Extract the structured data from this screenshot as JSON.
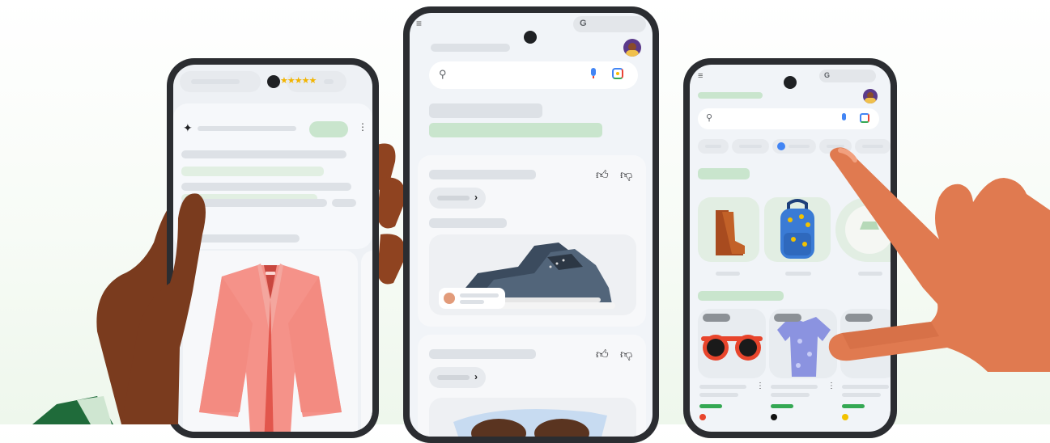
{
  "left_phone": {
    "rating_stars": "★★★★★",
    "ai_icon_name": "sparkle-icon",
    "product_icon_name": "pink-blazer"
  },
  "center_phone": {
    "search": {
      "icon": "search-icon",
      "mic": "mic-icon",
      "lens": "lens-icon"
    },
    "results": [
      {
        "product": "sneakers",
        "actions": [
          "thumbs-up-icon",
          "thumbs-down-icon"
        ]
      },
      {
        "product": "sunglasses",
        "actions": [
          "thumbs-up-icon",
          "thumbs-down-icon"
        ]
      }
    ]
  },
  "right_phone": {
    "search": {
      "icon": "search-icon",
      "mic": "mic-icon",
      "lens": "lens-icon"
    },
    "filter_chips": 5,
    "categories": [
      "boots",
      "backpack",
      "hat"
    ],
    "products": [
      {
        "name": "sunglasses",
        "swatch": "#e8452c"
      },
      {
        "name": "floral-shirt",
        "swatch": "#111111"
      },
      {
        "name": "item-3",
        "swatch": "#f2c200"
      }
    ]
  },
  "colors": {
    "accent_green": "#c9e5cd",
    "google_blue": "#4285f4",
    "skin_dark": "#7a3b1e",
    "skin_light": "#e07a50"
  }
}
